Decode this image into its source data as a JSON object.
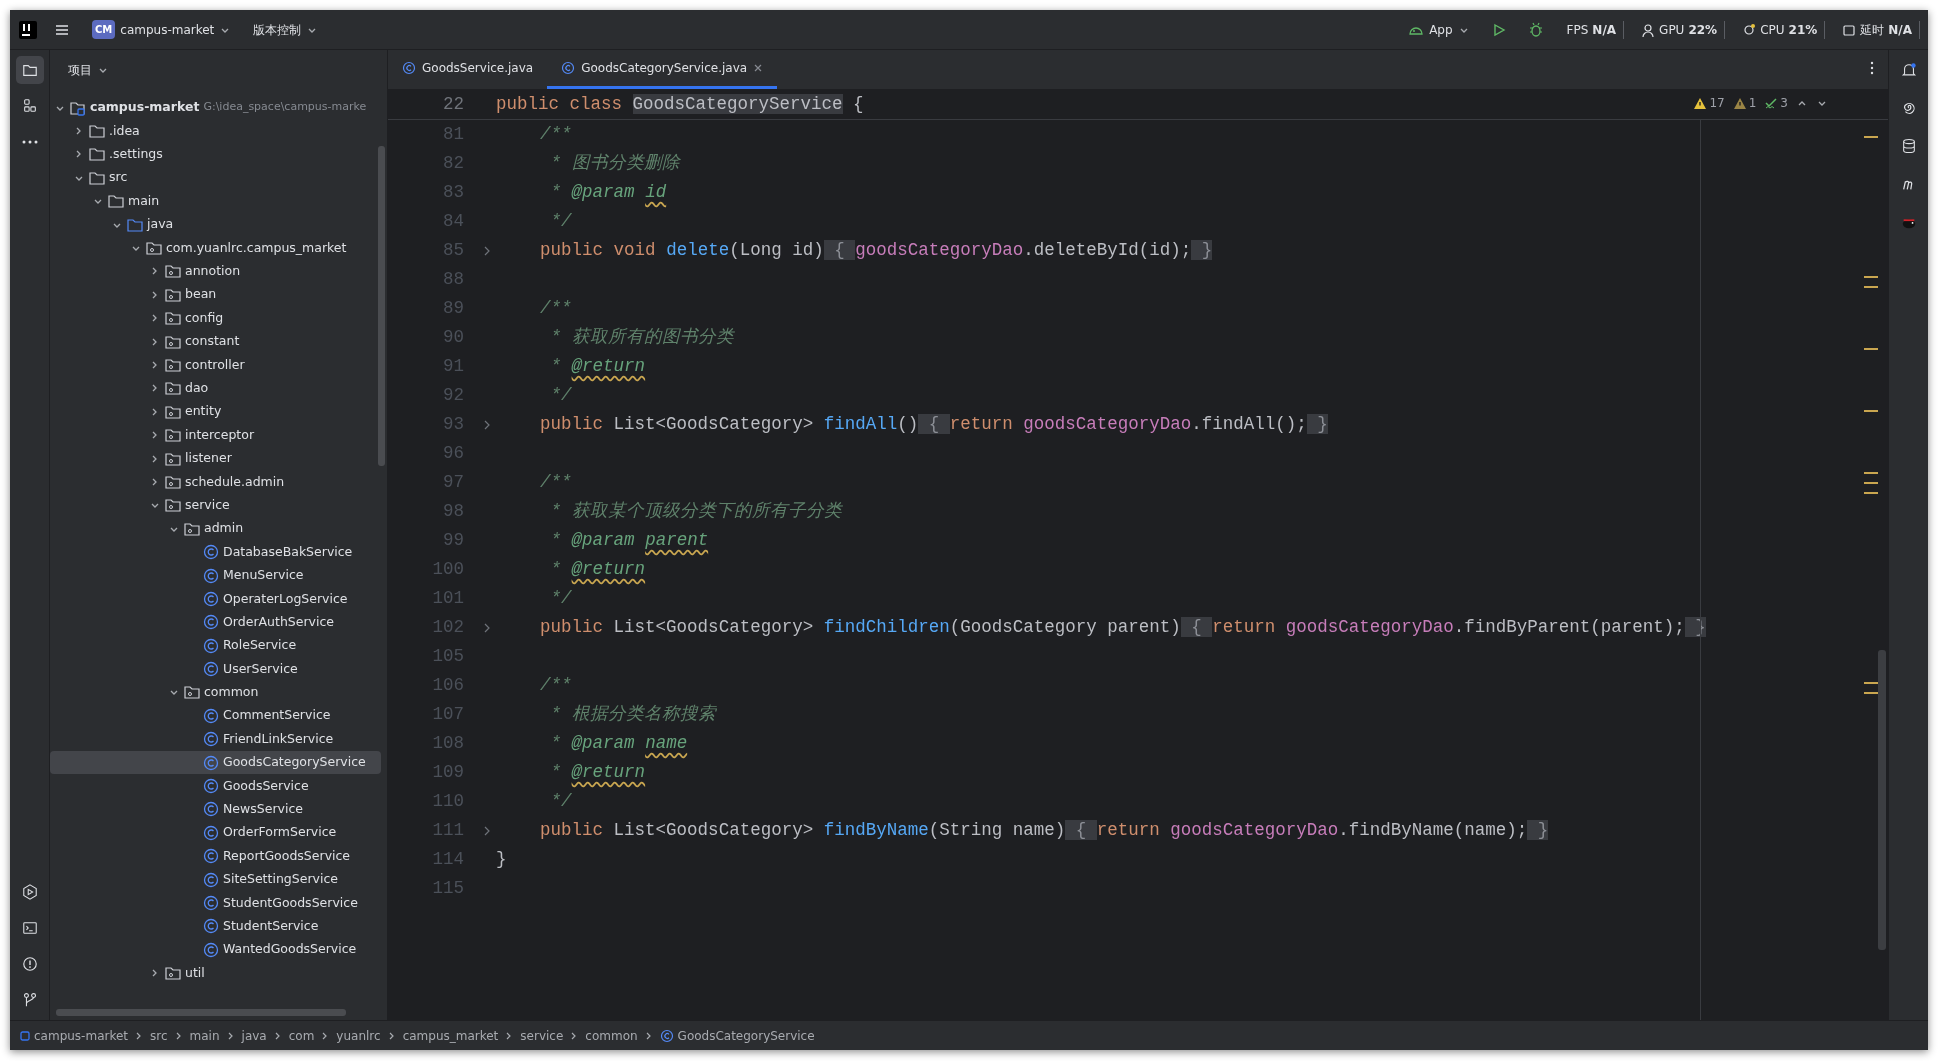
{
  "title_bar": {
    "project_badge": "CM",
    "project": "campus-market",
    "vcs": "版本控制",
    "run_config": "App",
    "monitors": [
      {
        "label": "FPS",
        "value": "N/A",
        "kind": "fps"
      },
      {
        "label": "GPU",
        "value": "22%",
        "kind": "gpu"
      },
      {
        "label": "CPU",
        "value": "21%",
        "kind": "cpu"
      },
      {
        "label": "延时",
        "value": "N/A",
        "kind": "latency"
      }
    ]
  },
  "project_panel": {
    "title": "项目",
    "tree": [
      {
        "label": "campus-market",
        "hint": "G:\\idea_space\\campus-marke",
        "kind": "module",
        "expanded": true,
        "selected": false,
        "children": [
          {
            "label": ".idea",
            "kind": "folder",
            "expanded": false,
            "selected": false
          },
          {
            "label": ".settings",
            "kind": "folder",
            "expanded": false,
            "selected": false
          },
          {
            "label": "src",
            "kind": "folder",
            "expanded": true,
            "selected": false,
            "children": [
              {
                "label": "main",
                "kind": "folder",
                "expanded": true,
                "selected": false,
                "children": [
                  {
                    "label": "java",
                    "kind": "source-root",
                    "expanded": true,
                    "selected": false,
                    "children": [
                      {
                        "label": "com.yuanlrc.campus_market",
                        "kind": "package",
                        "expanded": true,
                        "selected": false,
                        "children": [
                          {
                            "label": "annotion",
                            "kind": "package",
                            "expanded": false,
                            "selected": false
                          },
                          {
                            "label": "bean",
                            "kind": "package",
                            "expanded": false,
                            "selected": false
                          },
                          {
                            "label": "config",
                            "kind": "package",
                            "expanded": false,
                            "selected": false
                          },
                          {
                            "label": "constant",
                            "kind": "package",
                            "expanded": false,
                            "selected": false
                          },
                          {
                            "label": "controller",
                            "kind": "package",
                            "expanded": false,
                            "selected": false
                          },
                          {
                            "label": "dao",
                            "kind": "package",
                            "expanded": false,
                            "selected": false
                          },
                          {
                            "label": "entity",
                            "kind": "package",
                            "expanded": false,
                            "selected": false
                          },
                          {
                            "label": "interceptor",
                            "kind": "package",
                            "expanded": false,
                            "selected": false
                          },
                          {
                            "label": "listener",
                            "kind": "package",
                            "expanded": false,
                            "selected": false
                          },
                          {
                            "label": "schedule.admin",
                            "kind": "package",
                            "expanded": false,
                            "selected": false
                          },
                          {
                            "label": "service",
                            "kind": "package",
                            "expanded": true,
                            "selected": false,
                            "children": [
                              {
                                "label": "admin",
                                "kind": "package",
                                "expanded": true,
                                "selected": false,
                                "children": [
                                  {
                                    "label": "DatabaseBakService",
                                    "kind": "class",
                                    "selected": false
                                  },
                                  {
                                    "label": "MenuService",
                                    "kind": "class",
                                    "selected": false
                                  },
                                  {
                                    "label": "OperaterLogService",
                                    "kind": "class",
                                    "selected": false
                                  },
                                  {
                                    "label": "OrderAuthService",
                                    "kind": "class",
                                    "selected": false
                                  },
                                  {
                                    "label": "RoleService",
                                    "kind": "class",
                                    "selected": false
                                  },
                                  {
                                    "label": "UserService",
                                    "kind": "class",
                                    "selected": false
                                  }
                                ]
                              },
                              {
                                "label": "common",
                                "kind": "package",
                                "expanded": true,
                                "selected": false,
                                "children": [
                                  {
                                    "label": "CommentService",
                                    "kind": "class",
                                    "selected": false
                                  },
                                  {
                                    "label": "FriendLinkService",
                                    "kind": "class",
                                    "selected": false
                                  },
                                  {
                                    "label": "GoodsCategoryService",
                                    "kind": "class",
                                    "selected": true
                                  },
                                  {
                                    "label": "GoodsService",
                                    "kind": "class",
                                    "selected": false
                                  },
                                  {
                                    "label": "NewsService",
                                    "kind": "class",
                                    "selected": false
                                  },
                                  {
                                    "label": "OrderFormService",
                                    "kind": "class",
                                    "selected": false
                                  },
                                  {
                                    "label": "ReportGoodsService",
                                    "kind": "class",
                                    "selected": false
                                  },
                                  {
                                    "label": "SiteSettingService",
                                    "kind": "class",
                                    "selected": false
                                  },
                                  {
                                    "label": "StudentGoodsService",
                                    "kind": "class",
                                    "selected": false
                                  },
                                  {
                                    "label": "StudentService",
                                    "kind": "class",
                                    "selected": false
                                  },
                                  {
                                    "label": "WantedGoodsService",
                                    "kind": "class",
                                    "selected": false
                                  }
                                ]
                              }
                            ]
                          },
                          {
                            "label": "util",
                            "kind": "package",
                            "expanded": false,
                            "selected": false
                          }
                        ]
                      }
                    ]
                  }
                ]
              }
            ]
          }
        ]
      }
    ]
  },
  "tabs": [
    {
      "label": "GoodsService.java",
      "selected": false
    },
    {
      "label": "GoodsCategoryService.java",
      "selected": true
    }
  ],
  "inspections": {
    "warnings": "17",
    "weak_warnings": "1",
    "typos": "3"
  },
  "code_lines": [
    {
      "number": "22",
      "kind": "class",
      "tokens": [
        {
          "kind": "kw",
          "text": "public class "
        },
        {
          "kind": "class_name",
          "text": "GoodsCategoryService"
        },
        {
          "kind": "plain",
          "text": " {"
        }
      ]
    },
    {
      "number": "81",
      "kind": "member",
      "tokens": [
        {
          "kind": "doc",
          "text": "/**"
        }
      ]
    },
    {
      "number": "82",
      "kind": "doc",
      "tokens": [
        {
          "kind": "doc",
          "text": "* 图书分类删除"
        }
      ]
    },
    {
      "number": "83",
      "kind": "doc",
      "tokens": [
        {
          "kind": "doc",
          "text": "* "
        },
        {
          "kind": "doctag",
          "text": "@param "
        },
        {
          "kind": "docref_flagged",
          "text": "id"
        }
      ]
    },
    {
      "number": "84",
      "kind": "doc",
      "tokens": [
        {
          "kind": "doc",
          "text": "*/"
        }
      ]
    },
    {
      "number": "85",
      "kind": "folded",
      "tokens": [
        {
          "kind": "kw",
          "text": "public void "
        },
        {
          "kind": "fn",
          "text": "delete"
        },
        {
          "kind": "plain",
          "text": "(Long id)"
        },
        {
          "kind": "fold",
          "text": " { "
        },
        {
          "kind": "field",
          "text": "goodsCategoryDao"
        },
        {
          "kind": "plain",
          "text": ".deleteById(id);"
        },
        {
          "kind": "fold",
          "text": " }"
        }
      ]
    },
    {
      "number": "88",
      "kind": "blank"
    },
    {
      "number": "89",
      "kind": "member",
      "tokens": [
        {
          "kind": "doc",
          "text": "/**"
        }
      ]
    },
    {
      "number": "90",
      "kind": "doc",
      "tokens": [
        {
          "kind": "doc",
          "text": "* 获取所有的图书分类"
        }
      ]
    },
    {
      "number": "91",
      "kind": "doc",
      "tokens": [
        {
          "kind": "doc",
          "text": "* "
        },
        {
          "kind": "doctag_flagged",
          "text": "@return"
        }
      ]
    },
    {
      "number": "92",
      "kind": "doc",
      "tokens": [
        {
          "kind": "doc",
          "text": "*/"
        }
      ]
    },
    {
      "number": "93",
      "kind": "folded",
      "tokens": [
        {
          "kind": "kw",
          "text": "public "
        },
        {
          "kind": "plain",
          "text": "List<GoodsCategory> "
        },
        {
          "kind": "fn",
          "text": "findAll"
        },
        {
          "kind": "plain",
          "text": "()"
        },
        {
          "kind": "fold",
          "text": " { "
        },
        {
          "kind": "kw",
          "text": "return "
        },
        {
          "kind": "field",
          "text": "goodsCategoryDao"
        },
        {
          "kind": "plain",
          "text": ".findAll();"
        },
        {
          "kind": "fold",
          "text": " }"
        }
      ]
    },
    {
      "number": "96",
      "kind": "blank"
    },
    {
      "number": "97",
      "kind": "member",
      "tokens": [
        {
          "kind": "doc",
          "text": "/**"
        }
      ]
    },
    {
      "number": "98",
      "kind": "doc",
      "tokens": [
        {
          "kind": "doc",
          "text": "* 获取某个顶级分类下的所有子分类"
        }
      ]
    },
    {
      "number": "99",
      "kind": "doc",
      "tokens": [
        {
          "kind": "doc",
          "text": "* "
        },
        {
          "kind": "doctag",
          "text": "@param "
        },
        {
          "kind": "docref_flagged",
          "text": "parent"
        }
      ]
    },
    {
      "number": "100",
      "kind": "doc",
      "tokens": [
        {
          "kind": "doc",
          "text": "* "
        },
        {
          "kind": "doctag_flagged",
          "text": "@return"
        }
      ]
    },
    {
      "number": "101",
      "kind": "doc",
      "tokens": [
        {
          "kind": "doc",
          "text": "*/"
        }
      ]
    },
    {
      "number": "102",
      "kind": "folded",
      "tokens": [
        {
          "kind": "kw",
          "text": "public "
        },
        {
          "kind": "plain",
          "text": "List<GoodsCategory> "
        },
        {
          "kind": "fn",
          "text": "findChildren"
        },
        {
          "kind": "plain",
          "text": "(GoodsCategory parent)"
        },
        {
          "kind": "fold",
          "text": " { "
        },
        {
          "kind": "kw",
          "text": "return "
        },
        {
          "kind": "field",
          "text": "goodsCategoryDao"
        },
        {
          "kind": "plain",
          "text": ".findByParent(parent);"
        },
        {
          "kind": "fold",
          "text": " }"
        }
      ]
    },
    {
      "number": "105",
      "kind": "blank"
    },
    {
      "number": "106",
      "kind": "member",
      "tokens": [
        {
          "kind": "doc",
          "text": "/**"
        }
      ]
    },
    {
      "number": "107",
      "kind": "doc",
      "tokens": [
        {
          "kind": "doc",
          "text": "* 根据分类名称搜索"
        }
      ]
    },
    {
      "number": "108",
      "kind": "doc",
      "tokens": [
        {
          "kind": "doc",
          "text": "* "
        },
        {
          "kind": "doctag",
          "text": "@param "
        },
        {
          "kind": "docref_flagged",
          "text": "name"
        }
      ]
    },
    {
      "number": "109",
      "kind": "doc",
      "tokens": [
        {
          "kind": "doc",
          "text": "* "
        },
        {
          "kind": "doctag_flagged",
          "text": "@return"
        }
      ]
    },
    {
      "number": "110",
      "kind": "doc",
      "tokens": [
        {
          "kind": "doc",
          "text": "*/"
        }
      ]
    },
    {
      "number": "111",
      "kind": "folded",
      "tokens": [
        {
          "kind": "kw",
          "text": "public "
        },
        {
          "kind": "plain",
          "text": "List<GoodsCategory> "
        },
        {
          "kind": "fn",
          "text": "findByName"
        },
        {
          "kind": "plain",
          "text": "(String name)"
        },
        {
          "kind": "fold",
          "text": " { "
        },
        {
          "kind": "kw",
          "text": "return "
        },
        {
          "kind": "field",
          "text": "goodsCategoryDao"
        },
        {
          "kind": "plain",
          "text": ".findByName(name);"
        },
        {
          "kind": "fold",
          "text": " }"
        }
      ]
    },
    {
      "number": "114",
      "kind": "class",
      "tokens": [
        {
          "kind": "plain",
          "text": "}"
        }
      ]
    },
    {
      "number": "115",
      "kind": "blank"
    }
  ],
  "breadcrumbs": [
    {
      "label": "campus-market",
      "kind": "module"
    },
    {
      "label": "src",
      "kind": "plain"
    },
    {
      "label": "main",
      "kind": "plain"
    },
    {
      "label": "java",
      "kind": "plain"
    },
    {
      "label": "com",
      "kind": "plain"
    },
    {
      "label": "yuanlrc",
      "kind": "plain"
    },
    {
      "label": "campus_market",
      "kind": "plain"
    },
    {
      "label": "service",
      "kind": "plain"
    },
    {
      "label": "common",
      "kind": "plain"
    },
    {
      "label": "GoodsCategoryService",
      "kind": "class"
    }
  ]
}
